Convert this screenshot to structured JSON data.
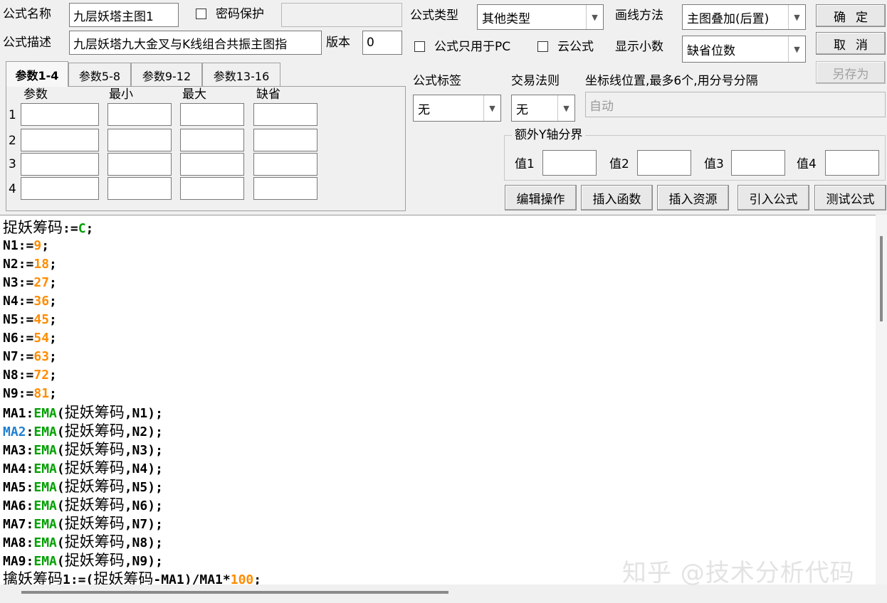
{
  "form": {
    "name_label": "公式名称",
    "name_value": "九层妖塔主图1",
    "password_label": "密码保护",
    "password_checked": false,
    "password_value": "",
    "desc_label": "公式描述",
    "desc_value": "九层妖塔九大金叉与K线组合共振主图指",
    "version_label": "版本",
    "version_value": "0",
    "type_label": "公式类型",
    "type_value": "其他类型",
    "draw_label": "画线方法",
    "draw_value": "主图叠加(后置)",
    "pc_only_label": "公式只用于PC",
    "cloud_label": "云公式",
    "decimals_label": "显示小数",
    "decimals_value": "缺省位数",
    "tag_label": "公式标签",
    "tag_value": "无",
    "trade_label": "交易法则",
    "trade_value": "无",
    "coord_label": "坐标线位置,最多6个,用分号分隔",
    "coord_value": "自动"
  },
  "buttons": {
    "ok": "确定",
    "cancel": "取消",
    "save_as": "另存为",
    "edit_ops": "编辑操作",
    "insert_func": "插入函数",
    "insert_res": "插入资源",
    "import_formula": "引入公式",
    "test_formula": "测试公式"
  },
  "tabs": [
    "参数1-4",
    "参数5-8",
    "参数9-12",
    "参数13-16"
  ],
  "params": {
    "headers": [
      "参数",
      "最小",
      "最大",
      "缺省"
    ],
    "rows": [
      "1",
      "2",
      "3",
      "4"
    ]
  },
  "yaxis": {
    "title": "额外Y轴分界",
    "labels": [
      "值1",
      "值2",
      "值3",
      "值4"
    ]
  },
  "code": [
    [
      [
        "cjk",
        "捉妖筹码"
      ],
      [
        "t",
        ":="
      ],
      [
        "fn",
        "C"
      ],
      [
        "t",
        ";"
      ]
    ],
    [
      [
        "t",
        "N1:="
      ],
      [
        "num",
        "9"
      ],
      [
        "t",
        ";"
      ]
    ],
    [
      [
        "t",
        "N2:="
      ],
      [
        "num",
        "18"
      ],
      [
        "t",
        ";"
      ]
    ],
    [
      [
        "t",
        "N3:="
      ],
      [
        "num",
        "27"
      ],
      [
        "t",
        ";"
      ]
    ],
    [
      [
        "t",
        "N4:="
      ],
      [
        "num",
        "36"
      ],
      [
        "t",
        ";"
      ]
    ],
    [
      [
        "t",
        "N5:="
      ],
      [
        "num",
        "45"
      ],
      [
        "t",
        ";"
      ]
    ],
    [
      [
        "t",
        "N6:="
      ],
      [
        "num",
        "54"
      ],
      [
        "t",
        ";"
      ]
    ],
    [
      [
        "t",
        "N7:="
      ],
      [
        "num",
        "63"
      ],
      [
        "t",
        ";"
      ]
    ],
    [
      [
        "t",
        "N8:="
      ],
      [
        "num",
        "72"
      ],
      [
        "t",
        ";"
      ]
    ],
    [
      [
        "t",
        "N9:="
      ],
      [
        "num",
        "81"
      ],
      [
        "t",
        ";"
      ]
    ],
    [
      [
        "t",
        "MA1:"
      ],
      [
        "fn",
        "EMA"
      ],
      [
        "t",
        "("
      ],
      [
        "cjk",
        "捉妖筹码"
      ],
      [
        "t",
        ",N1);"
      ]
    ],
    [
      [
        "var2",
        "MA2"
      ],
      [
        "t",
        ":"
      ],
      [
        "fn",
        "EMA"
      ],
      [
        "t",
        "("
      ],
      [
        "cjk",
        "捉妖筹码"
      ],
      [
        "t",
        ",N2);"
      ]
    ],
    [
      [
        "t",
        "MA3:"
      ],
      [
        "fn",
        "EMA"
      ],
      [
        "t",
        "("
      ],
      [
        "cjk",
        "捉妖筹码"
      ],
      [
        "t",
        ",N3);"
      ]
    ],
    [
      [
        "t",
        "MA4:"
      ],
      [
        "fn",
        "EMA"
      ],
      [
        "t",
        "("
      ],
      [
        "cjk",
        "捉妖筹码"
      ],
      [
        "t",
        ",N4);"
      ]
    ],
    [
      [
        "t",
        "MA5:"
      ],
      [
        "fn",
        "EMA"
      ],
      [
        "t",
        "("
      ],
      [
        "cjk",
        "捉妖筹码"
      ],
      [
        "t",
        ",N5);"
      ]
    ],
    [
      [
        "t",
        "MA6:"
      ],
      [
        "fn",
        "EMA"
      ],
      [
        "t",
        "("
      ],
      [
        "cjk",
        "捉妖筹码"
      ],
      [
        "t",
        ",N6);"
      ]
    ],
    [
      [
        "t",
        "MA7:"
      ],
      [
        "fn",
        "EMA"
      ],
      [
        "t",
        "("
      ],
      [
        "cjk",
        "捉妖筹码"
      ],
      [
        "t",
        ",N7);"
      ]
    ],
    [
      [
        "t",
        "MA8:"
      ],
      [
        "fn",
        "EMA"
      ],
      [
        "t",
        "("
      ],
      [
        "cjk",
        "捉妖筹码"
      ],
      [
        "t",
        ",N8);"
      ]
    ],
    [
      [
        "t",
        "MA9:"
      ],
      [
        "fn",
        "EMA"
      ],
      [
        "t",
        "("
      ],
      [
        "cjk",
        "捉妖筹码"
      ],
      [
        "t",
        ",N9);"
      ]
    ],
    [
      [
        "cjk",
        "擒妖筹码"
      ],
      [
        "t",
        "1:=("
      ],
      [
        "cjk",
        "捉妖筹码"
      ],
      [
        "t",
        "-MA1)/MA1*"
      ],
      [
        "num",
        "100"
      ],
      [
        "t",
        ";"
      ]
    ]
  ],
  "colors": {
    "number": "#ff8c00",
    "function": "#00a000",
    "highlight_var": "#1e7fd0"
  },
  "watermark": "知乎 @技术分析代码"
}
